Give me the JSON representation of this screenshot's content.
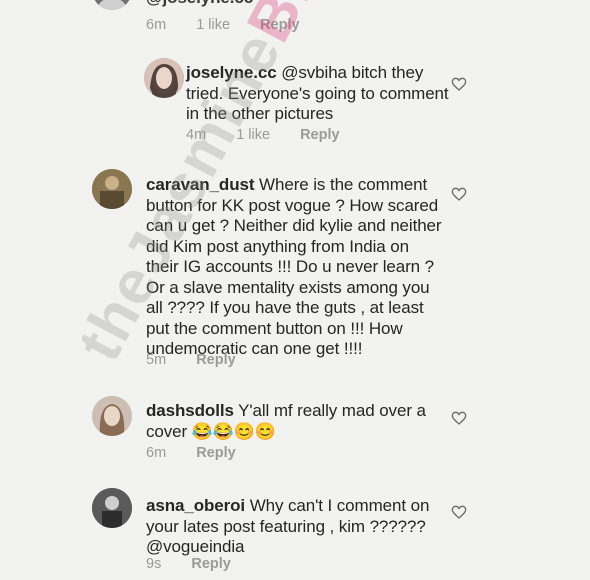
{
  "top_comment": {
    "username_partial": "@joselyne.cc",
    "time": "6m",
    "likes": "1 like",
    "reply": "Reply"
  },
  "comments": [
    {
      "username": "joselyne.cc",
      "text": "@svbiha bitch they tried. Everyone's going to comment in the other pictures",
      "time": "4m",
      "likes": "1 like",
      "reply": "Reply"
    },
    {
      "username": "caravan_dust",
      "text": "Where is the comment button for KK post vogue ? How scared can u get ? Neither did kylie and neither did Kim post anything from India on their IG accounts !!! Do u never learn ? Or a slave mentality exists among you all ???? If you have the guts , at least put the comment button on !!! How undemocratic can one get !!!!",
      "time": "5m",
      "reply": "Reply"
    },
    {
      "username": "dashsdolls",
      "text": "Y'all mf really mad over a cover 😂😂😊😊",
      "time": "6m",
      "reply": "Reply"
    },
    {
      "username": "asna_oberoi",
      "text": "Why can't I comment on your lates post featuring , kim ?????? @vogueindia",
      "time": "9s",
      "reply": "Reply"
    }
  ],
  "watermark": {
    "part1": "theJasmine",
    "part2": "BRAND"
  },
  "icons": {
    "like": "heart-outline-icon",
    "avatar": "user-avatar"
  },
  "colors": {
    "background": "#f2f2f0",
    "text": "#262626",
    "meta": "#9a9a9a"
  }
}
